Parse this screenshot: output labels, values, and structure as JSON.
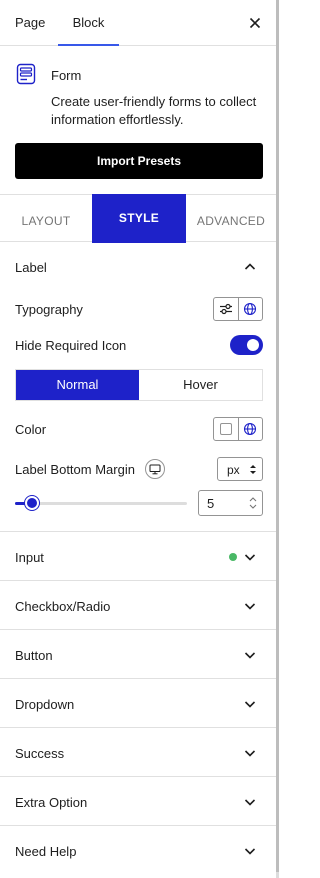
{
  "top_tabs": {
    "page": "Page",
    "block": "Block"
  },
  "block_card": {
    "name": "Form",
    "description": "Create user-friendly forms to collect information effortlessly."
  },
  "import_button": "Import Presets",
  "style_tabs": {
    "layout": "LAYOUT",
    "style": "STYLE",
    "advanced": "ADVANCED"
  },
  "label_section": {
    "title": "Label",
    "typography": "Typography",
    "hide_required_icon": "Hide Required Icon",
    "hide_required_icon_enabled": true,
    "states": {
      "normal": "Normal",
      "hover": "Hover",
      "active": "Normal"
    },
    "color": "Color",
    "bottom_margin": {
      "label": "Label Bottom Margin",
      "unit": "px",
      "value": "5",
      "slider_fraction": 0.1
    }
  },
  "sections": [
    {
      "title": "Input",
      "status": "active"
    },
    {
      "title": "Checkbox/Radio"
    },
    {
      "title": "Button"
    },
    {
      "title": "Dropdown"
    },
    {
      "title": "Success"
    },
    {
      "title": "Extra Option"
    },
    {
      "title": "Need Help"
    }
  ],
  "colors": {
    "accent": "#1e22c9",
    "tab_underline": "#3858e9",
    "status_green": "#4ab866"
  }
}
